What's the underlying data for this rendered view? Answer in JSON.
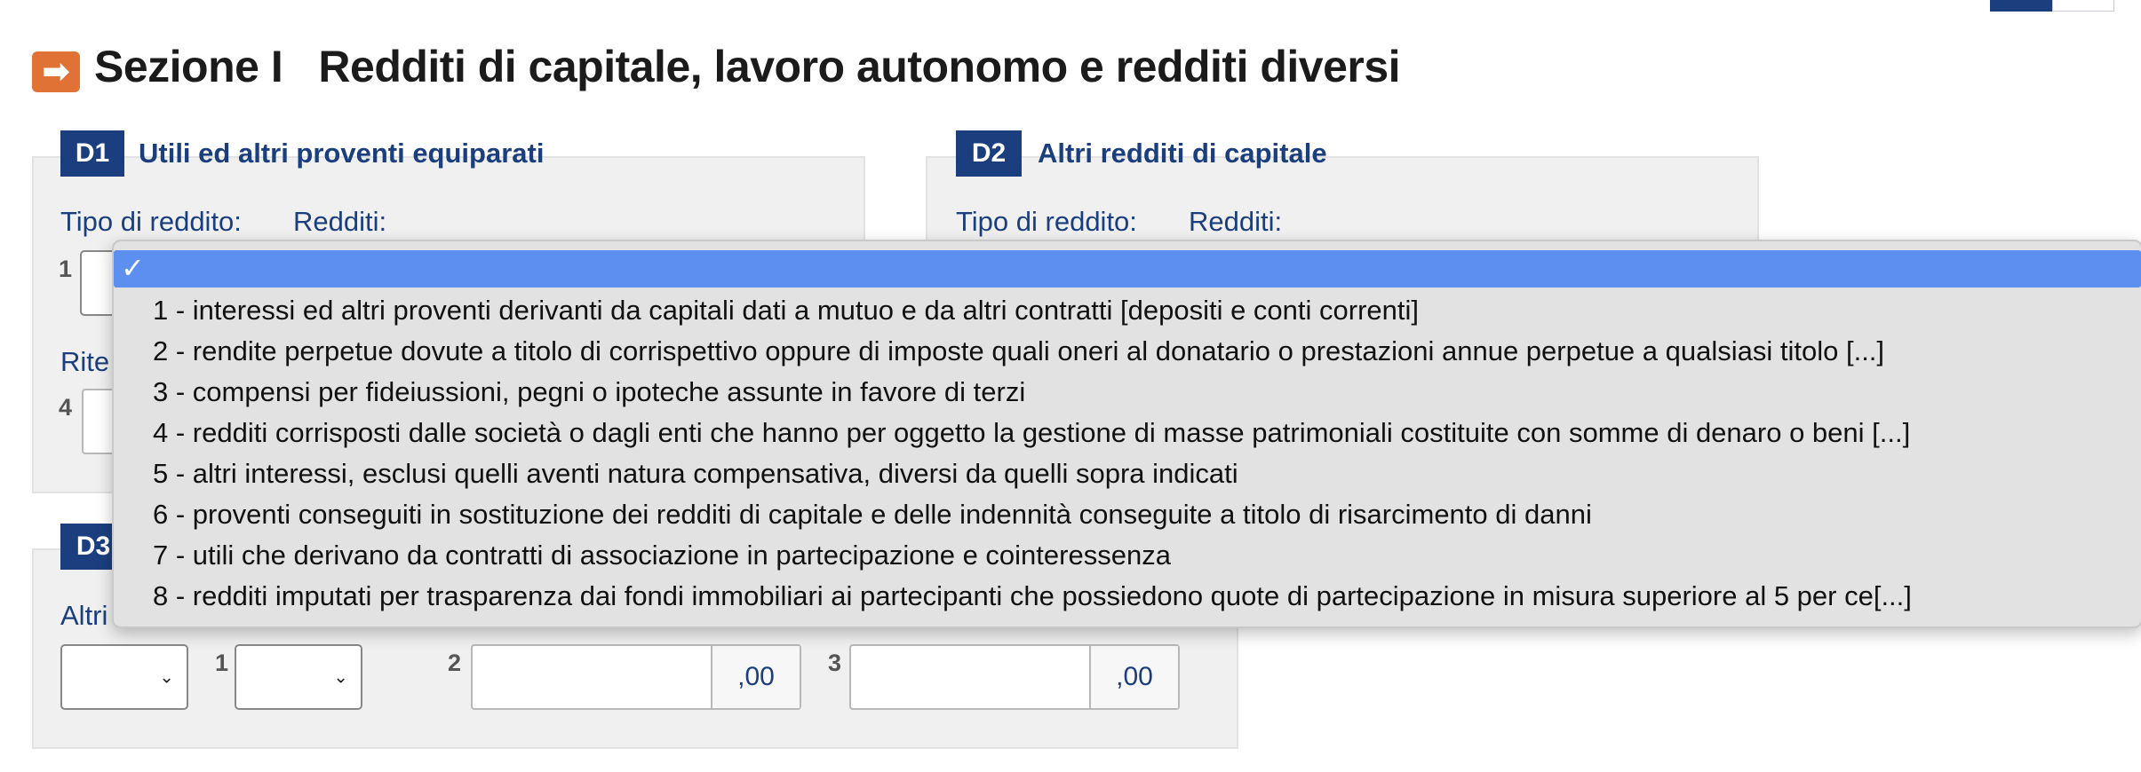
{
  "section": {
    "title": "Sezione I   Redditi di capitale, lavoro autonomo e redditi diversi"
  },
  "panels": {
    "d1": {
      "badge": "D1",
      "title": "Utili ed altri proventi equiparati",
      "label_tipo": "Tipo di reddito:",
      "label_redditi": "Redditi:",
      "num_1": "1",
      "label_rite_partial": "Rite",
      "num_4": "4"
    },
    "d2": {
      "badge": "D2",
      "title": "Altri redditi di capitale",
      "label_tipo": "Tipo di reddito:",
      "label_redditi": "Redditi:"
    },
    "d3": {
      "badge_partial": "D3",
      "label_altri_partial": "Altri dati:",
      "num_1": "1",
      "num_2": "2",
      "num_3": "3",
      "suffix_2": ",00",
      "suffix_3": ",00"
    }
  },
  "dropdown": {
    "selected_mark": "✓",
    "options": [
      "1 - interessi ed altri proventi derivanti da capitali dati a mutuo e da altri contratti [depositi e conti correnti]",
      "2 - rendite perpetue dovute a titolo di corrispettivo oppure di imposte quali oneri al donatario o prestazioni annue perpetue a qualsiasi titolo [...]",
      "3 - compensi per fideiussioni, pegni o ipoteche assunte in favore di terzi",
      "4 - redditi corrisposti dalle società o dagli enti che hanno per oggetto la gestione di masse patrimoniali costituite con somme di denaro o beni [...]",
      "5 - altri interessi, esclusi quelli aventi natura compensativa, diversi da quelli sopra indicati",
      "6 - proventi conseguiti in sostituzione dei redditi di capitale e delle indennità conseguite a titolo di risarcimento di danni",
      "7 - utili che derivano da contratti di associazione in partecipazione e cointeressenza",
      "8 - redditi imputati per trasparenza dai fondi immobiliari ai partecipanti che possiedono quote di partecipazione in misura superiore al 5 per ce[...]"
    ]
  },
  "colors": {
    "accent_orange": "#e07236",
    "brand_blue": "#1b3f7e",
    "selection_blue": "#5c8ff0"
  },
  "icons": {
    "section_arrow": "arrow-right-icon",
    "select_chevron": "chevron-down-icon",
    "check": "check-icon"
  }
}
